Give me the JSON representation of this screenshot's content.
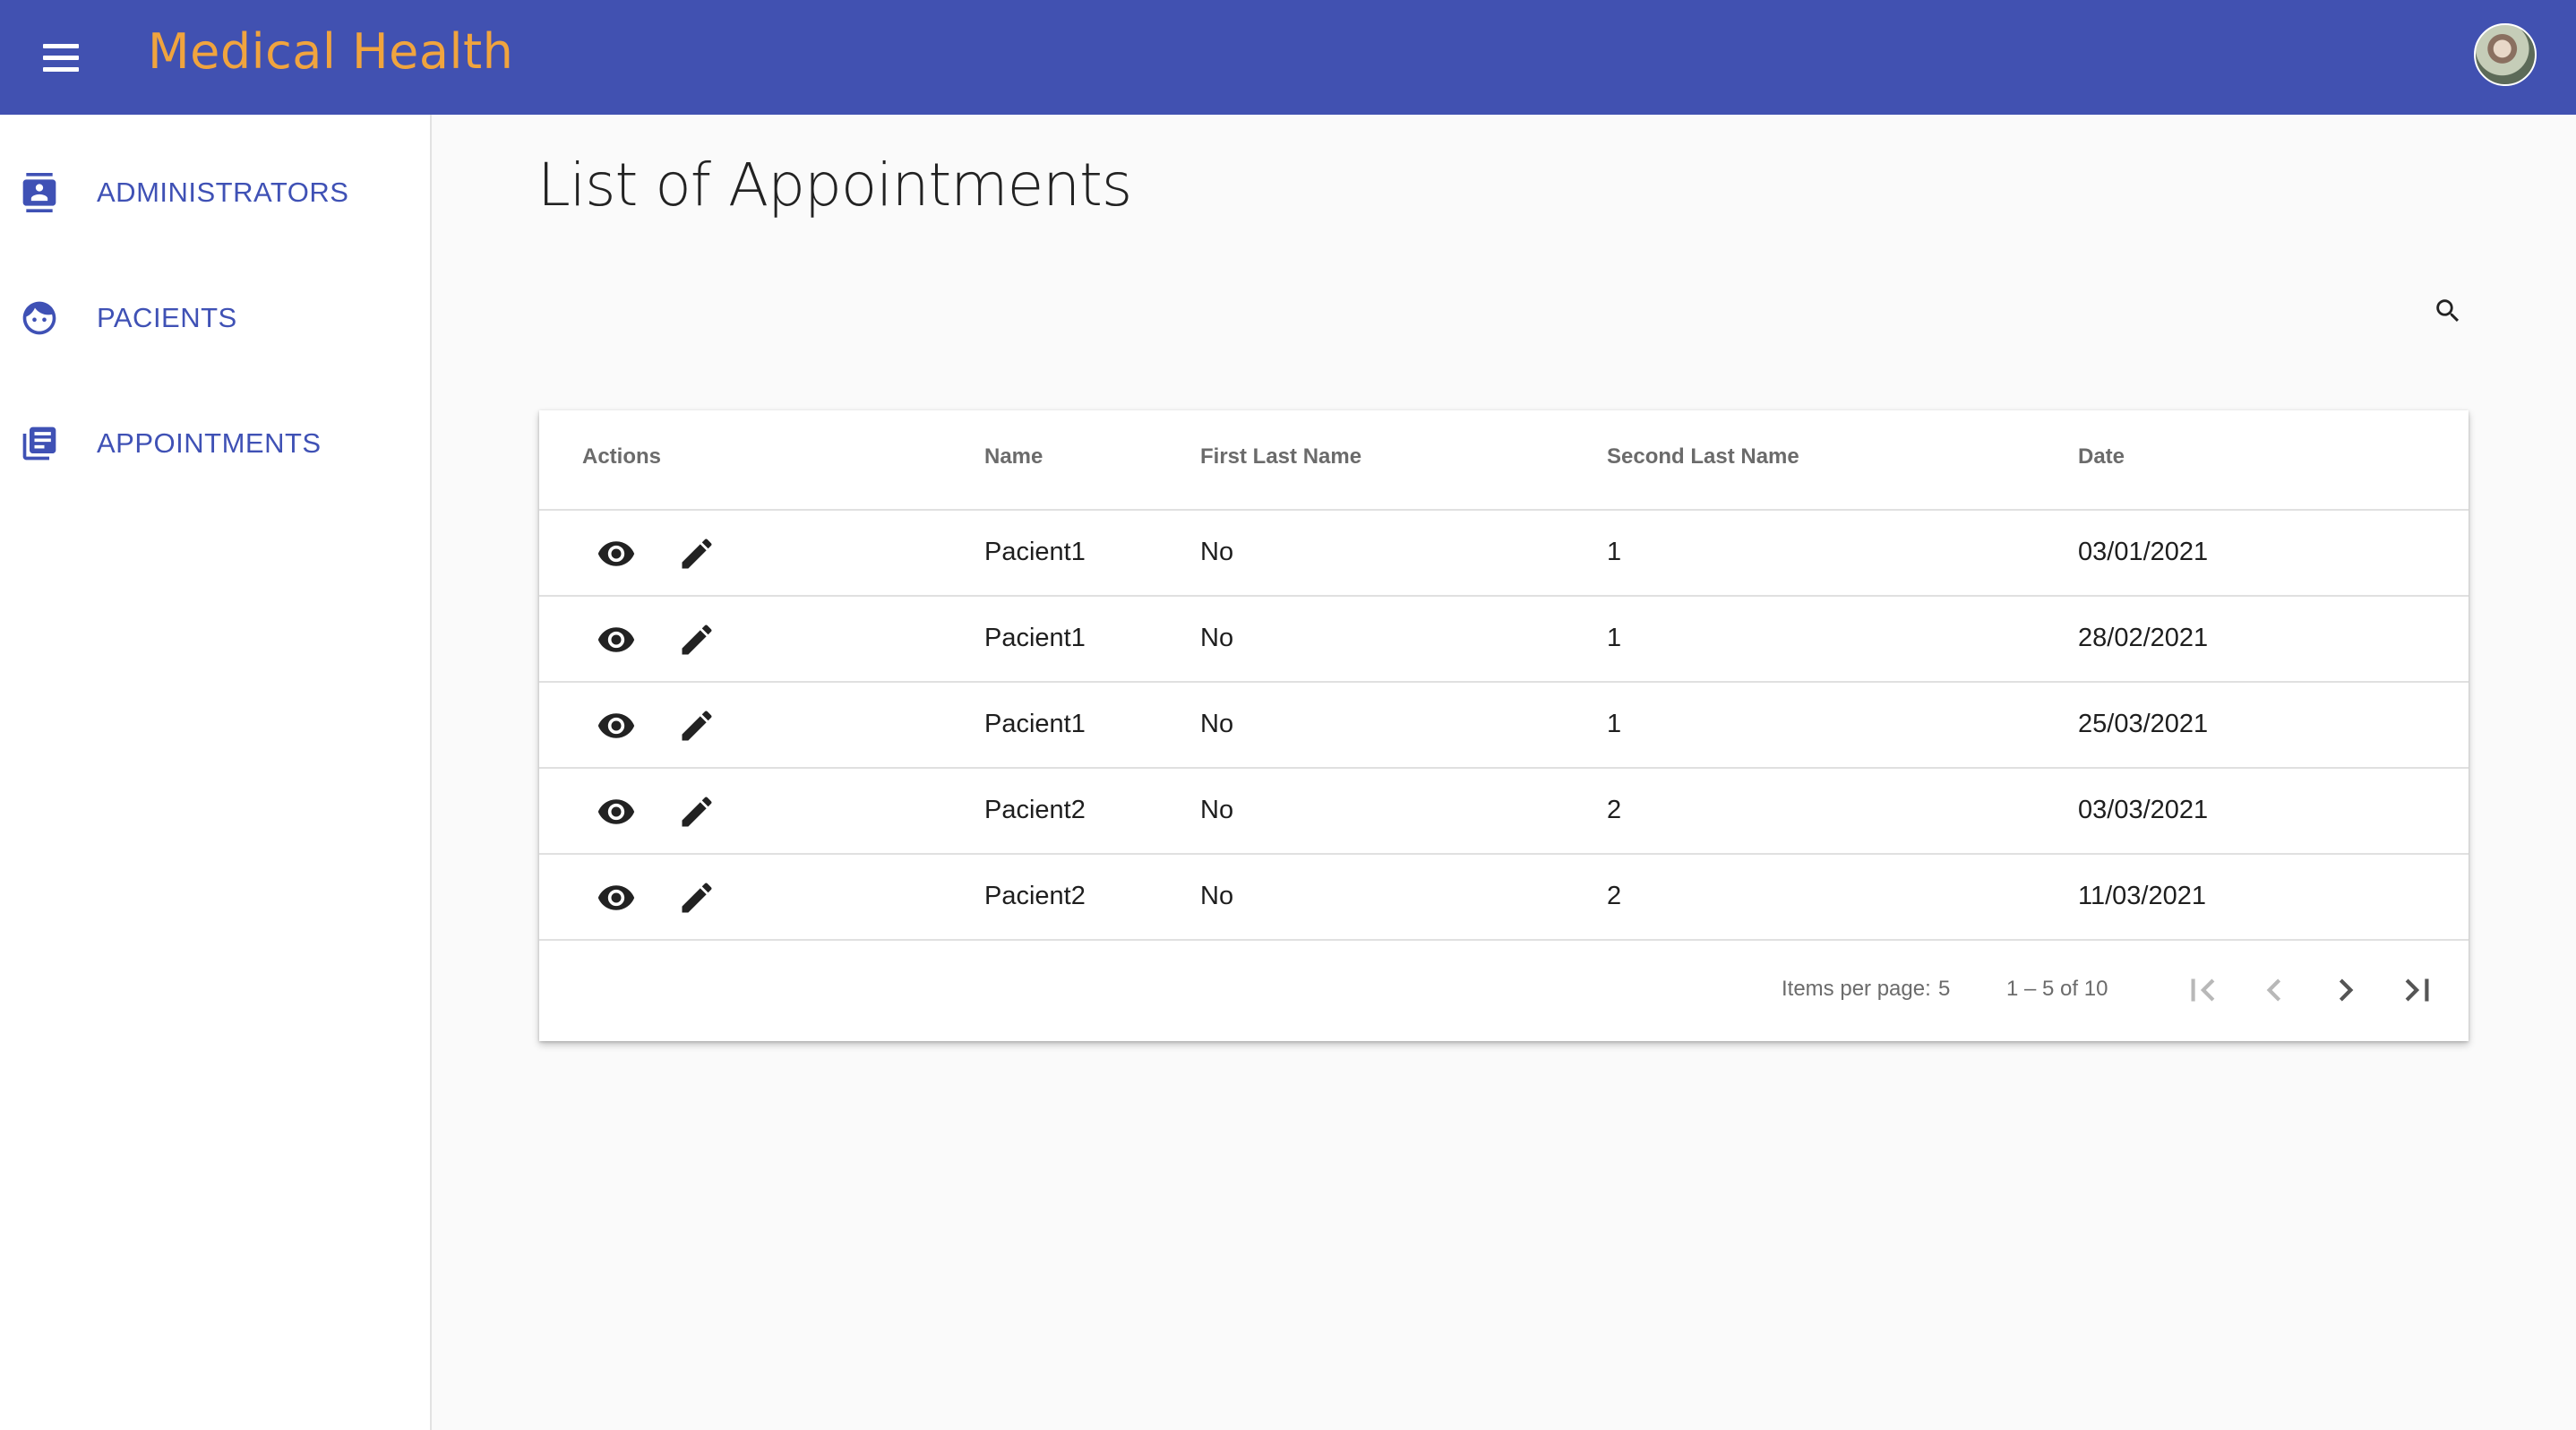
{
  "header": {
    "app_title": "Medical Health",
    "menu_icon": "menu-icon",
    "brand_color": "#4151b1",
    "title_color": "#f0a43e"
  },
  "sidebar": {
    "items": [
      {
        "label": "ADMINISTRATORS",
        "icon": "contact-card-icon"
      },
      {
        "label": "PACIENTS",
        "icon": "face-icon"
      },
      {
        "label": "APPOINTMENTS",
        "icon": "library-books-icon"
      }
    ],
    "accent_color": "#3f51b5"
  },
  "main": {
    "page_title": "List of Appointments",
    "search_icon": "search-icon"
  },
  "table": {
    "columns": [
      "Actions",
      "Name",
      "First Last Name",
      "Second Last Name",
      "Date"
    ],
    "rows": [
      {
        "name": "Pacient1",
        "first_last_name": "No",
        "second_last_name": "1",
        "date": "03/01/2021"
      },
      {
        "name": "Pacient1",
        "first_last_name": "No",
        "second_last_name": "1",
        "date": "28/02/2021"
      },
      {
        "name": "Pacient1",
        "first_last_name": "No",
        "second_last_name": "1",
        "date": "25/03/2021"
      },
      {
        "name": "Pacient2",
        "first_last_name": "No",
        "second_last_name": "2",
        "date": "03/03/2021"
      },
      {
        "name": "Pacient2",
        "first_last_name": "No",
        "second_last_name": "2",
        "date": "11/03/2021"
      }
    ],
    "row_actions": [
      "view-icon",
      "edit-icon"
    ]
  },
  "paginator": {
    "items_per_page_label": "Items per page:",
    "items_per_page_value": "5",
    "range_label": "1 – 5 of 10",
    "buttons": [
      "first-page-icon",
      "previous-page-icon",
      "next-page-icon",
      "last-page-icon"
    ]
  }
}
